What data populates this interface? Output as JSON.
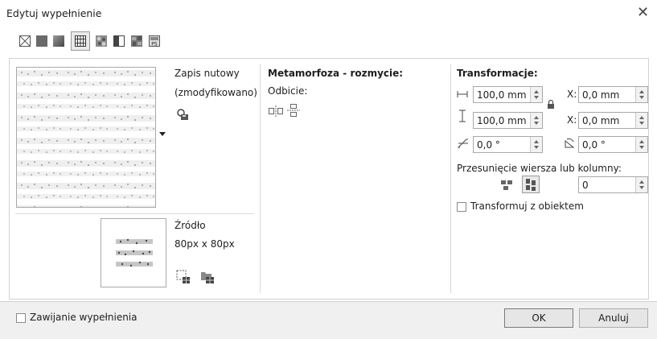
{
  "window": {
    "title": "Edytuj wypełnienie"
  },
  "toolbar": {
    "items": [
      {
        "name": "no-fill-icon",
        "label": "Brak wypełnienia"
      },
      {
        "name": "uniform-fill-icon",
        "label": "Wypełnienie jednolite"
      },
      {
        "name": "fountain-fill-icon",
        "label": "Wypełnienie tonalne"
      },
      {
        "name": "vector-pattern-icon",
        "label": "Wypełnienie deseniem wektorowym"
      },
      {
        "name": "bitmap-pattern-icon",
        "label": "Wypełnienie deseniem mapy bitowej"
      },
      {
        "name": "two-color-pattern-icon",
        "label": "Wypełnienie deseniem dwukolorowym"
      },
      {
        "name": "texture-fill-icon",
        "label": "Wypełnienie teksturą"
      },
      {
        "name": "postscript-fill-icon",
        "label": "PS"
      }
    ],
    "selected_index": 3
  },
  "pattern": {
    "name_line1": "Zapis nutowy",
    "name_line2": "(zmodyfikowano)"
  },
  "source": {
    "label": "Źródło",
    "size": "80px x 80px"
  },
  "metamorphosis": {
    "heading": "Metamorfoza - rozmycie:",
    "mirror_label": "Odbicie:"
  },
  "transform": {
    "heading": "Transformacje:",
    "width": "100,0 mm",
    "height": "100,0 mm",
    "x": "0,0 mm",
    "y": "0,0 mm",
    "x_label": "X:",
    "y_label": "X:",
    "skew": "0,0 °",
    "rotation": "0,0 °",
    "offset_label": "Przesunięcie wiersza lub kolumny:",
    "offset_value": "0",
    "transform_with_object_label": "Transformuj z obiektem",
    "transform_with_object_checked": false
  },
  "footer": {
    "wrap_fill_label": "Zawijanie wypełnienia",
    "wrap_fill_checked": false,
    "ok_label": "OK",
    "cancel_label": "Anuluj"
  }
}
